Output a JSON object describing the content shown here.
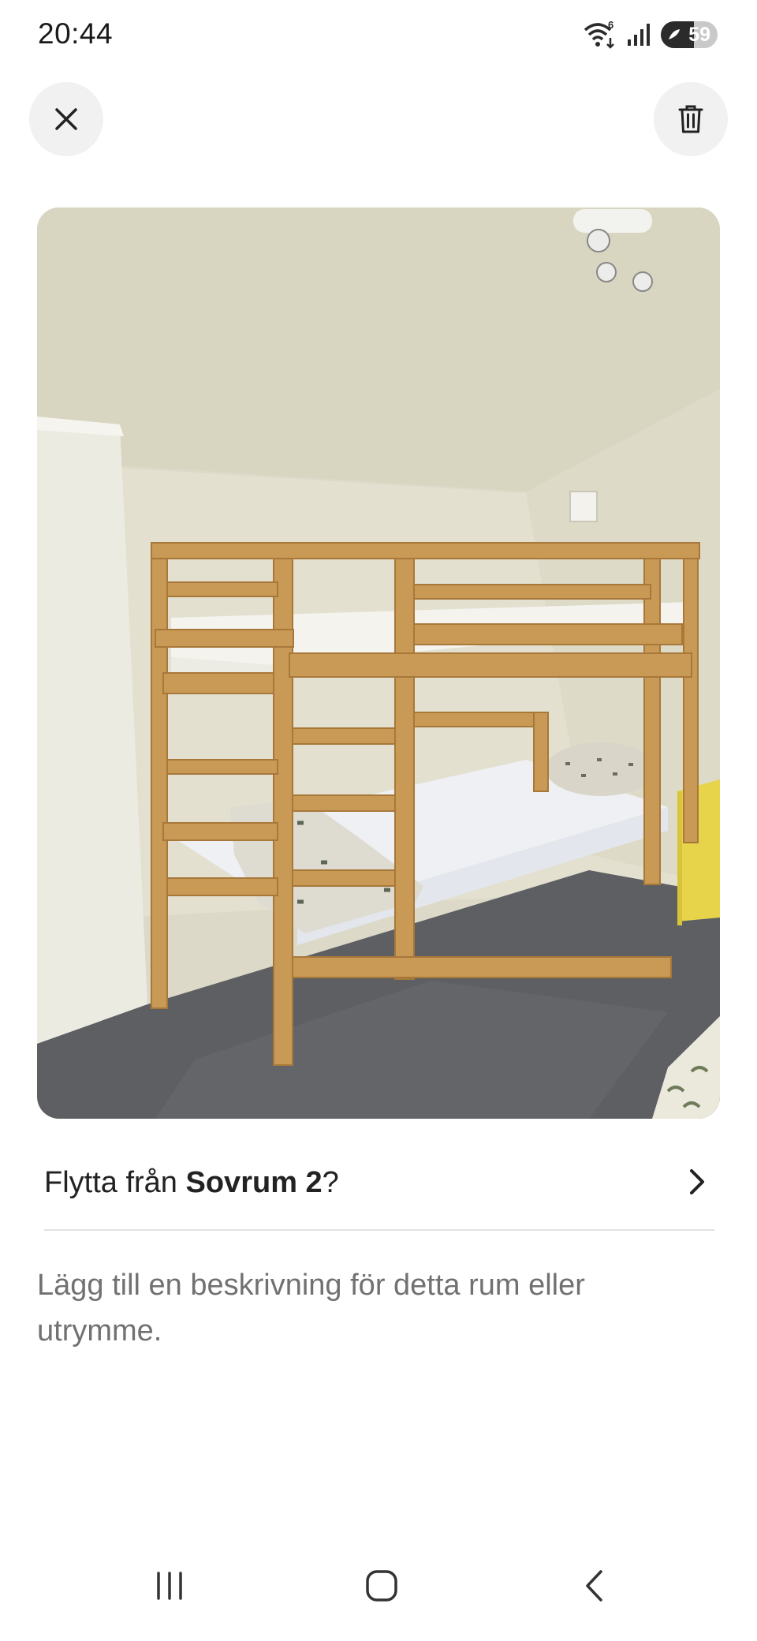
{
  "status_bar": {
    "time": "20:44",
    "wifi_badge": "6",
    "battery_level": "59",
    "battery_fraction": 0.59
  },
  "header": {
    "close_icon": "close-icon",
    "delete_icon": "trash-icon"
  },
  "photo": {
    "subject": "room-photo"
  },
  "move_row": {
    "prefix": "Flytta från ",
    "room_name": "Sovrum 2",
    "suffix": "?",
    "chevron_icon": "chevron-right-icon"
  },
  "description": {
    "placeholder": "Lägg till en beskrivning för detta rum eller utrymme."
  },
  "nav_bar": {
    "recent_icon": "recent-apps-icon",
    "home_icon": "home-icon",
    "back_icon": "back-icon"
  },
  "colors": {
    "accent_text": "#222222",
    "secondary_text": "#717171",
    "button_bg": "#f1f1f1",
    "divider": "#e2e2e2"
  }
}
